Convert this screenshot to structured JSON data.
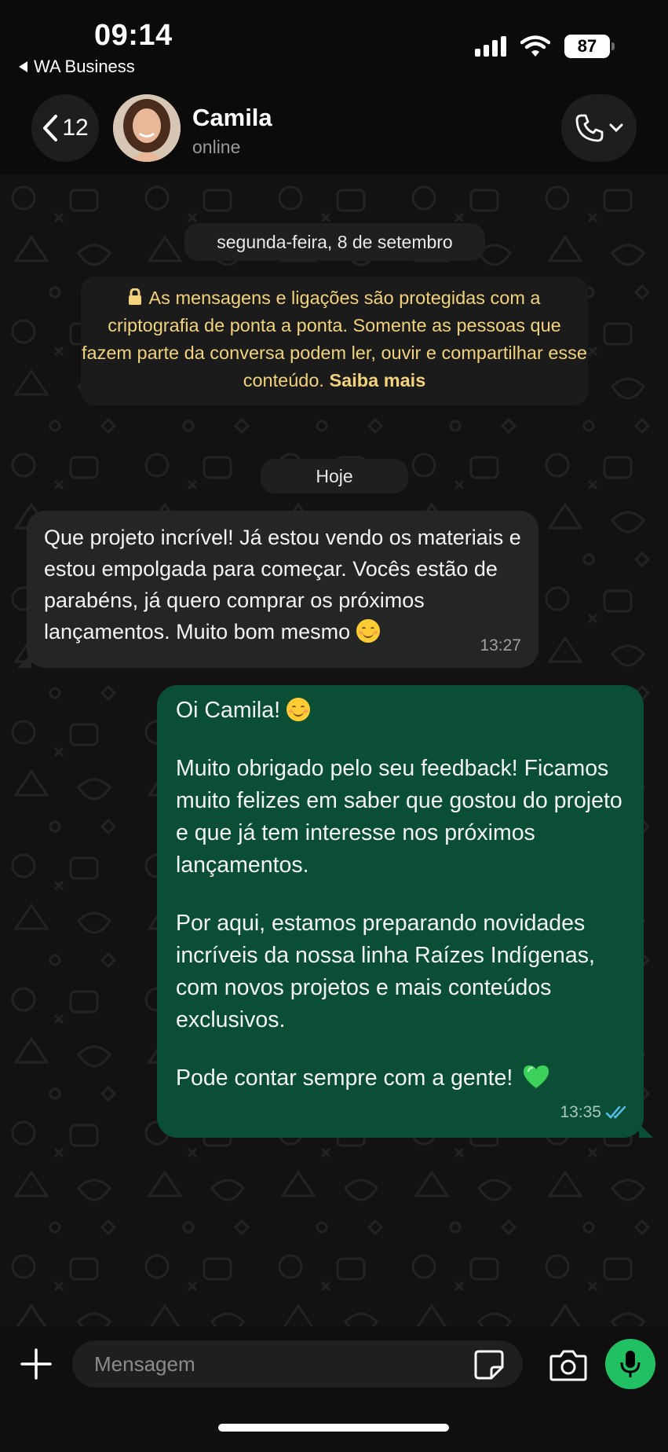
{
  "status_bar": {
    "time": "09:14",
    "back_app": "WA Business",
    "battery": "87"
  },
  "header": {
    "back_count": "12",
    "contact_name": "Camila",
    "contact_status": "online"
  },
  "chat": {
    "date_separator": "segunda-feira, 8 de setembro",
    "encryption_notice": {
      "text": "As mensagens e ligações são protegidas com a criptografia de ponta a ponta. Somente as pessoas que fazem parte da conversa podem ler, ouvir e compartilhar esse conteúdo.",
      "link": "Saiba mais"
    },
    "today_separator": "Hoje",
    "messages": [
      {
        "direction": "incoming",
        "text": "Que projeto incrível! Já estou vendo os materiais e estou empolgada para começar. Vocês estão de parabéns, já quero comprar os próximos lançamentos. Muito bom mesmo",
        "emoji": "smiling-face",
        "time": "13:27"
      },
      {
        "direction": "outgoing",
        "paragraphs": [
          "Oi Camila!",
          "Muito obrigado pelo seu feedback! Ficamos muito felizes em saber que gostou do projeto e que já tem interesse nos próximos lançamentos.",
          "Por aqui, estamos preparando novidades incríveis da nossa linha Raízes Indígenas, com novos projetos e mais conteúdos exclusivos.",
          "Pode contar sempre com a gente!"
        ],
        "emojis": [
          "smiling-face",
          "green-heart"
        ],
        "time": "13:35",
        "status": "read"
      }
    ]
  },
  "composer": {
    "placeholder": "Mensagem"
  },
  "colors": {
    "outgoing_bubble": "#0a4f35",
    "incoming_bubble": "#242626",
    "mic_button": "#21c063",
    "encryption_text": "#f2d27a",
    "read_ticks": "#53bdeb"
  },
  "icons": [
    "signal-icon",
    "wifi-icon",
    "back-chevron-icon",
    "phone-icon",
    "chevron-down-icon",
    "lock-icon",
    "plus-icon",
    "sticker-icon",
    "camera-icon",
    "mic-icon",
    "double-check-icon"
  ]
}
